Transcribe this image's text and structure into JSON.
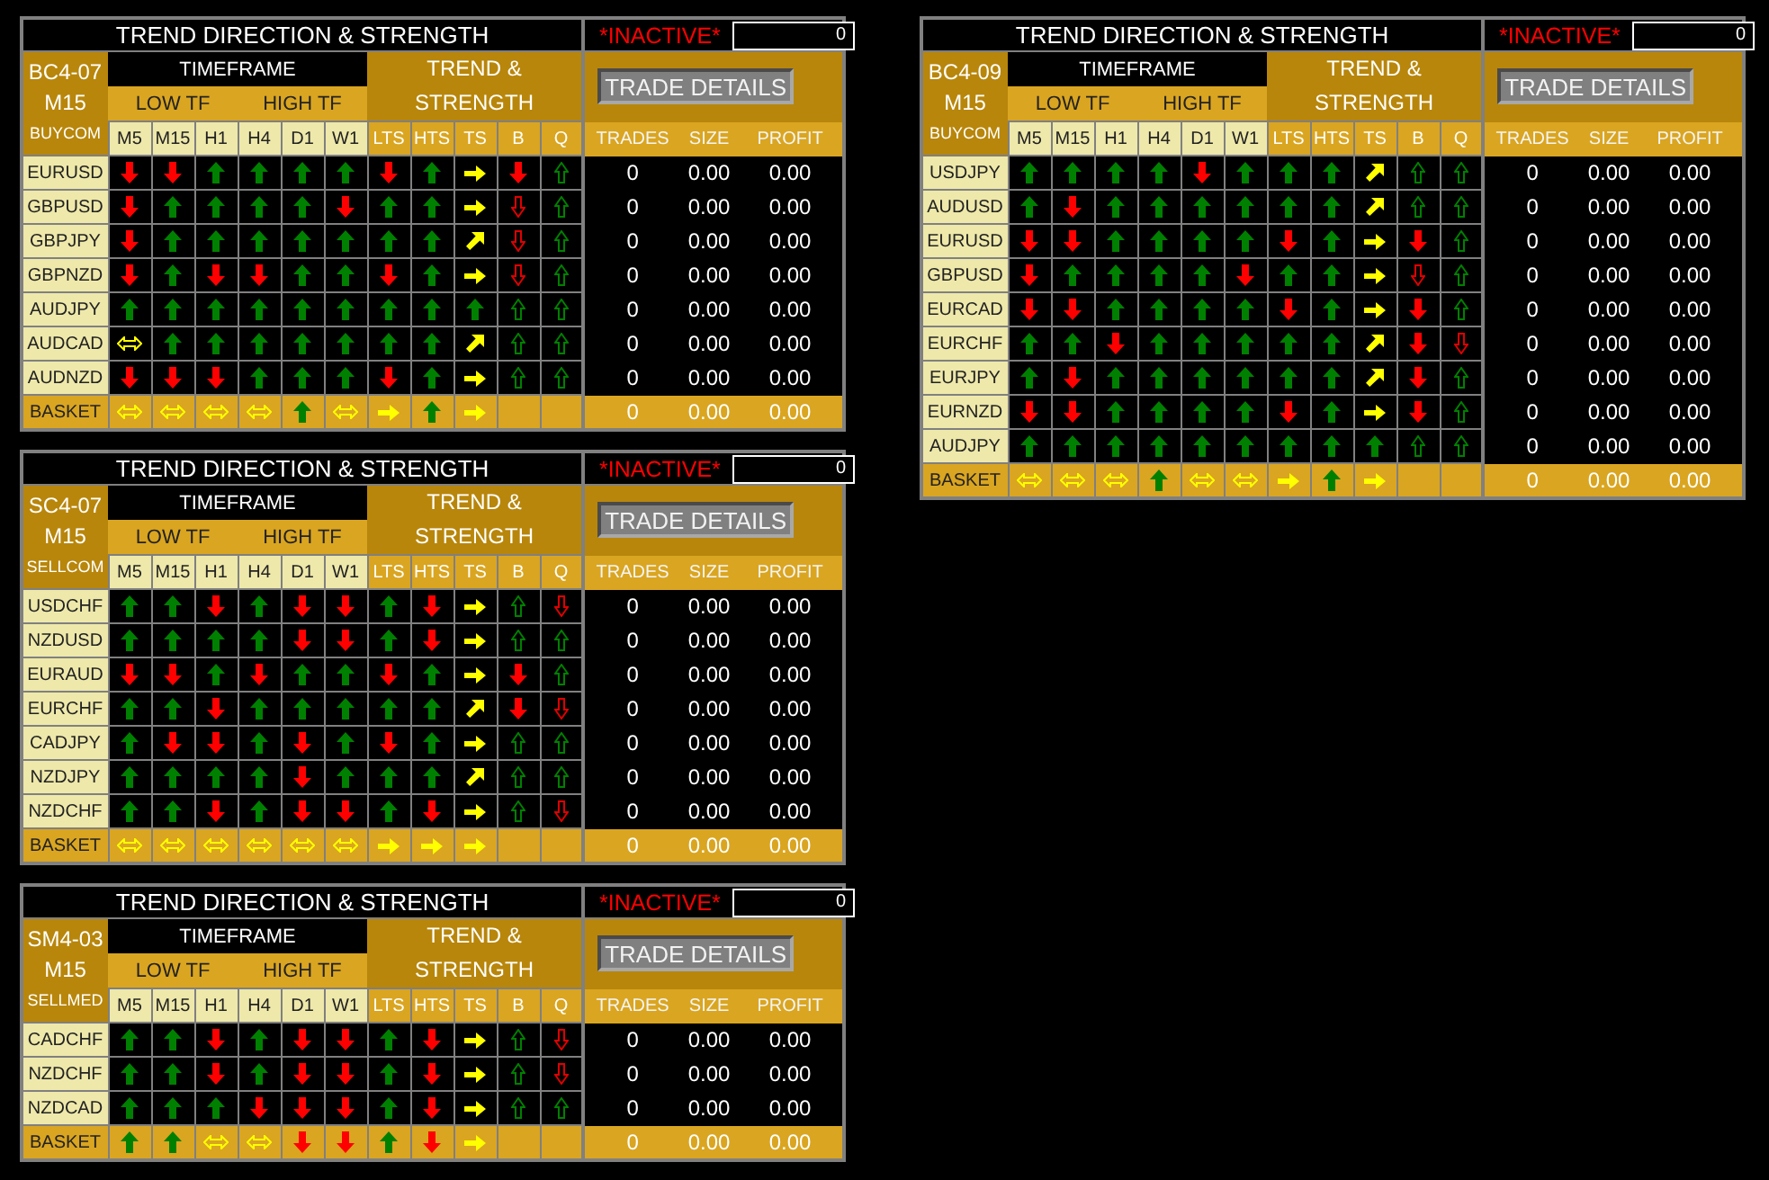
{
  "panels": [
    {
      "title": "TREND DIRECTION & STRENGTH",
      "status": "*INACTIVE*",
      "counter": "0",
      "code": "BC4-07",
      "chart_timeframe": "M15",
      "mode": "BUYCOM",
      "timeframe_header": "TIMEFRAME",
      "low_tf": "LOW TF",
      "high_tf": "HIGH TF",
      "trend_header": "TREND & STRENGTH",
      "button": "TRADE DETAILS",
      "columns": [
        "M5",
        "M15",
        "H1",
        "H4",
        "D1",
        "W1",
        "LTS",
        "HTS",
        "TS",
        "B",
        "Q"
      ],
      "stats_columns": [
        "TRADES",
        "SIZE",
        "PROFIT"
      ],
      "rows": [
        {
          "pair": "EURUSD",
          "signals": [
            {
              "kind": "down"
            },
            {
              "kind": "down"
            },
            {
              "kind": "up"
            },
            {
              "kind": "up"
            },
            {
              "kind": "up"
            },
            {
              "kind": "up"
            },
            {
              "kind": "down"
            },
            {
              "kind": "up"
            },
            {
              "kind": "right"
            },
            {
              "kind": "down"
            },
            {
              "kind": "up_outline"
            }
          ],
          "trades": "0",
          "size": "0.00",
          "profit": "0.00"
        },
        {
          "pair": "GBPUSD",
          "signals": [
            {
              "kind": "down"
            },
            {
              "kind": "up"
            },
            {
              "kind": "up"
            },
            {
              "kind": "up"
            },
            {
              "kind": "up"
            },
            {
              "kind": "down"
            },
            {
              "kind": "up"
            },
            {
              "kind": "up"
            },
            {
              "kind": "right"
            },
            {
              "kind": "down_outline"
            },
            {
              "kind": "up_outline"
            }
          ],
          "trades": "0",
          "size": "0.00",
          "profit": "0.00"
        },
        {
          "pair": "GBPJPY",
          "signals": [
            {
              "kind": "down"
            },
            {
              "kind": "up"
            },
            {
              "kind": "up"
            },
            {
              "kind": "up"
            },
            {
              "kind": "up"
            },
            {
              "kind": "up"
            },
            {
              "kind": "up"
            },
            {
              "kind": "up"
            },
            {
              "kind": "up_right"
            },
            {
              "kind": "down_outline"
            },
            {
              "kind": "up_outline"
            }
          ],
          "trades": "0",
          "size": "0.00",
          "profit": "0.00"
        },
        {
          "pair": "GBPNZD",
          "signals": [
            {
              "kind": "down"
            },
            {
              "kind": "up"
            },
            {
              "kind": "down"
            },
            {
              "kind": "down"
            },
            {
              "kind": "up"
            },
            {
              "kind": "up"
            },
            {
              "kind": "down"
            },
            {
              "kind": "up"
            },
            {
              "kind": "right"
            },
            {
              "kind": "down_outline"
            },
            {
              "kind": "up_outline"
            }
          ],
          "trades": "0",
          "size": "0.00",
          "profit": "0.00"
        },
        {
          "pair": "AUDJPY",
          "signals": [
            {
              "kind": "up"
            },
            {
              "kind": "up"
            },
            {
              "kind": "up"
            },
            {
              "kind": "up"
            },
            {
              "kind": "up"
            },
            {
              "kind": "up"
            },
            {
              "kind": "up"
            },
            {
              "kind": "up"
            },
            {
              "kind": "up"
            },
            {
              "kind": "up_outline"
            },
            {
              "kind": "up_outline"
            }
          ],
          "trades": "0",
          "size": "0.00",
          "profit": "0.00"
        },
        {
          "pair": "AUDCAD",
          "signals": [
            {
              "kind": "flat"
            },
            {
              "kind": "up"
            },
            {
              "kind": "up"
            },
            {
              "kind": "up"
            },
            {
              "kind": "up"
            },
            {
              "kind": "up"
            },
            {
              "kind": "up"
            },
            {
              "kind": "up"
            },
            {
              "kind": "up_right"
            },
            {
              "kind": "up_outline"
            },
            {
              "kind": "up_outline"
            }
          ],
          "trades": "0",
          "size": "0.00",
          "profit": "0.00"
        },
        {
          "pair": "AUDNZD",
          "signals": [
            {
              "kind": "down"
            },
            {
              "kind": "down"
            },
            {
              "kind": "down"
            },
            {
              "kind": "up"
            },
            {
              "kind": "up"
            },
            {
              "kind": "up"
            },
            {
              "kind": "down"
            },
            {
              "kind": "up"
            },
            {
              "kind": "right"
            },
            {
              "kind": "up_outline"
            },
            {
              "kind": "up_outline"
            }
          ],
          "trades": "0",
          "size": "0.00",
          "profit": "0.00"
        }
      ],
      "basket": {
        "label": "BASKET",
        "signals": [
          {
            "kind": "flat"
          },
          {
            "kind": "flat"
          },
          {
            "kind": "flat"
          },
          {
            "kind": "flat"
          },
          {
            "kind": "up"
          },
          {
            "kind": "flat"
          },
          {
            "kind": "right"
          },
          {
            "kind": "up"
          },
          {
            "kind": "right"
          }
        ],
        "trades": "0",
        "size": "0.00",
        "profit": "0.00"
      }
    },
    {
      "title": "TREND DIRECTION & STRENGTH",
      "status": "*INACTIVE*",
      "counter": "0",
      "code": "BC4-09",
      "chart_timeframe": "M15",
      "mode": "BUYCOM",
      "timeframe_header": "TIMEFRAME",
      "low_tf": "LOW TF",
      "high_tf": "HIGH TF",
      "trend_header": "TREND & STRENGTH",
      "button": "TRADE DETAILS",
      "columns": [
        "M5",
        "M15",
        "H1",
        "H4",
        "D1",
        "W1",
        "LTS",
        "HTS",
        "TS",
        "B",
        "Q"
      ],
      "stats_columns": [
        "TRADES",
        "SIZE",
        "PROFIT"
      ],
      "rows": [
        {
          "pair": "USDJPY",
          "signals": [
            {
              "kind": "up"
            },
            {
              "kind": "up"
            },
            {
              "kind": "up"
            },
            {
              "kind": "up"
            },
            {
              "kind": "down"
            },
            {
              "kind": "up"
            },
            {
              "kind": "up"
            },
            {
              "kind": "up"
            },
            {
              "kind": "up_right"
            },
            {
              "kind": "up_outline"
            },
            {
              "kind": "up_outline"
            }
          ],
          "trades": "0",
          "size": "0.00",
          "profit": "0.00"
        },
        {
          "pair": "AUDUSD",
          "signals": [
            {
              "kind": "up"
            },
            {
              "kind": "down"
            },
            {
              "kind": "up"
            },
            {
              "kind": "up"
            },
            {
              "kind": "up"
            },
            {
              "kind": "up"
            },
            {
              "kind": "up"
            },
            {
              "kind": "up"
            },
            {
              "kind": "up_right"
            },
            {
              "kind": "up_outline"
            },
            {
              "kind": "up_outline"
            }
          ],
          "trades": "0",
          "size": "0.00",
          "profit": "0.00"
        },
        {
          "pair": "EURUSD",
          "signals": [
            {
              "kind": "down"
            },
            {
              "kind": "down"
            },
            {
              "kind": "up"
            },
            {
              "kind": "up"
            },
            {
              "kind": "up"
            },
            {
              "kind": "up"
            },
            {
              "kind": "down"
            },
            {
              "kind": "up"
            },
            {
              "kind": "right"
            },
            {
              "kind": "down"
            },
            {
              "kind": "up_outline"
            }
          ],
          "trades": "0",
          "size": "0.00",
          "profit": "0.00"
        },
        {
          "pair": "GBPUSD",
          "signals": [
            {
              "kind": "down"
            },
            {
              "kind": "up"
            },
            {
              "kind": "up"
            },
            {
              "kind": "up"
            },
            {
              "kind": "up"
            },
            {
              "kind": "down"
            },
            {
              "kind": "up"
            },
            {
              "kind": "up"
            },
            {
              "kind": "right"
            },
            {
              "kind": "down_outline"
            },
            {
              "kind": "up_outline"
            }
          ],
          "trades": "0",
          "size": "0.00",
          "profit": "0.00"
        },
        {
          "pair": "EURCAD",
          "signals": [
            {
              "kind": "down"
            },
            {
              "kind": "down"
            },
            {
              "kind": "up"
            },
            {
              "kind": "up"
            },
            {
              "kind": "up"
            },
            {
              "kind": "up"
            },
            {
              "kind": "down"
            },
            {
              "kind": "up"
            },
            {
              "kind": "right"
            },
            {
              "kind": "down"
            },
            {
              "kind": "up_outline"
            }
          ],
          "trades": "0",
          "size": "0.00",
          "profit": "0.00"
        },
        {
          "pair": "EURCHF",
          "signals": [
            {
              "kind": "up"
            },
            {
              "kind": "up"
            },
            {
              "kind": "down"
            },
            {
              "kind": "up"
            },
            {
              "kind": "up"
            },
            {
              "kind": "up"
            },
            {
              "kind": "up"
            },
            {
              "kind": "up"
            },
            {
              "kind": "up_right"
            },
            {
              "kind": "down"
            },
            {
              "kind": "down_outline"
            }
          ],
          "trades": "0",
          "size": "0.00",
          "profit": "0.00"
        },
        {
          "pair": "EURJPY",
          "signals": [
            {
              "kind": "up"
            },
            {
              "kind": "down"
            },
            {
              "kind": "up"
            },
            {
              "kind": "up"
            },
            {
              "kind": "up"
            },
            {
              "kind": "up"
            },
            {
              "kind": "up"
            },
            {
              "kind": "up"
            },
            {
              "kind": "up_right"
            },
            {
              "kind": "down"
            },
            {
              "kind": "up_outline"
            }
          ],
          "trades": "0",
          "size": "0.00",
          "profit": "0.00"
        },
        {
          "pair": "EURNZD",
          "signals": [
            {
              "kind": "down"
            },
            {
              "kind": "down"
            },
            {
              "kind": "up"
            },
            {
              "kind": "up"
            },
            {
              "kind": "up"
            },
            {
              "kind": "up"
            },
            {
              "kind": "down"
            },
            {
              "kind": "up"
            },
            {
              "kind": "right"
            },
            {
              "kind": "down"
            },
            {
              "kind": "up_outline"
            }
          ],
          "trades": "0",
          "size": "0.00",
          "profit": "0.00"
        },
        {
          "pair": "AUDJPY",
          "signals": [
            {
              "kind": "up"
            },
            {
              "kind": "up"
            },
            {
              "kind": "up"
            },
            {
              "kind": "up"
            },
            {
              "kind": "up"
            },
            {
              "kind": "up"
            },
            {
              "kind": "up"
            },
            {
              "kind": "up"
            },
            {
              "kind": "up"
            },
            {
              "kind": "up_outline"
            },
            {
              "kind": "up_outline"
            }
          ],
          "trades": "0",
          "size": "0.00",
          "profit": "0.00"
        }
      ],
      "basket": {
        "label": "BASKET",
        "signals": [
          {
            "kind": "flat"
          },
          {
            "kind": "flat"
          },
          {
            "kind": "flat"
          },
          {
            "kind": "up"
          },
          {
            "kind": "flat"
          },
          {
            "kind": "flat"
          },
          {
            "kind": "right"
          },
          {
            "kind": "up"
          },
          {
            "kind": "right"
          }
        ],
        "trades": "0",
        "size": "0.00",
        "profit": "0.00"
      }
    },
    {
      "title": "TREND DIRECTION & STRENGTH",
      "status": "*INACTIVE*",
      "counter": "0",
      "code": "SC4-07",
      "chart_timeframe": "M15",
      "mode": "SELLCOM",
      "timeframe_header": "TIMEFRAME",
      "low_tf": "LOW TF",
      "high_tf": "HIGH TF",
      "trend_header": "TREND & STRENGTH",
      "button": "TRADE DETAILS",
      "columns": [
        "M5",
        "M15",
        "H1",
        "H4",
        "D1",
        "W1",
        "LTS",
        "HTS",
        "TS",
        "B",
        "Q"
      ],
      "stats_columns": [
        "TRADES",
        "SIZE",
        "PROFIT"
      ],
      "rows": [
        {
          "pair": "USDCHF",
          "signals": [
            {
              "kind": "up"
            },
            {
              "kind": "up"
            },
            {
              "kind": "down"
            },
            {
              "kind": "up"
            },
            {
              "kind": "down"
            },
            {
              "kind": "down"
            },
            {
              "kind": "up"
            },
            {
              "kind": "down"
            },
            {
              "kind": "right"
            },
            {
              "kind": "up_outline"
            },
            {
              "kind": "down_outline"
            }
          ],
          "trades": "0",
          "size": "0.00",
          "profit": "0.00"
        },
        {
          "pair": "NZDUSD",
          "signals": [
            {
              "kind": "up"
            },
            {
              "kind": "up"
            },
            {
              "kind": "up"
            },
            {
              "kind": "up"
            },
            {
              "kind": "down"
            },
            {
              "kind": "down"
            },
            {
              "kind": "up"
            },
            {
              "kind": "down"
            },
            {
              "kind": "right"
            },
            {
              "kind": "up_outline"
            },
            {
              "kind": "up_outline"
            }
          ],
          "trades": "0",
          "size": "0.00",
          "profit": "0.00"
        },
        {
          "pair": "EURAUD",
          "signals": [
            {
              "kind": "down"
            },
            {
              "kind": "down"
            },
            {
              "kind": "up"
            },
            {
              "kind": "down"
            },
            {
              "kind": "up"
            },
            {
              "kind": "up"
            },
            {
              "kind": "down"
            },
            {
              "kind": "up"
            },
            {
              "kind": "right"
            },
            {
              "kind": "down"
            },
            {
              "kind": "up_outline"
            }
          ],
          "trades": "0",
          "size": "0.00",
          "profit": "0.00"
        },
        {
          "pair": "EURCHF",
          "signals": [
            {
              "kind": "up"
            },
            {
              "kind": "up"
            },
            {
              "kind": "down"
            },
            {
              "kind": "up"
            },
            {
              "kind": "up"
            },
            {
              "kind": "up"
            },
            {
              "kind": "up"
            },
            {
              "kind": "up"
            },
            {
              "kind": "up_right"
            },
            {
              "kind": "down"
            },
            {
              "kind": "down_outline"
            }
          ],
          "trades": "0",
          "size": "0.00",
          "profit": "0.00"
        },
        {
          "pair": "CADJPY",
          "signals": [
            {
              "kind": "up"
            },
            {
              "kind": "down"
            },
            {
              "kind": "down"
            },
            {
              "kind": "up"
            },
            {
              "kind": "down"
            },
            {
              "kind": "up"
            },
            {
              "kind": "down"
            },
            {
              "kind": "up"
            },
            {
              "kind": "right"
            },
            {
              "kind": "up_outline"
            },
            {
              "kind": "up_outline"
            }
          ],
          "trades": "0",
          "size": "0.00",
          "profit": "0.00"
        },
        {
          "pair": "NZDJPY",
          "signals": [
            {
              "kind": "up"
            },
            {
              "kind": "up"
            },
            {
              "kind": "up"
            },
            {
              "kind": "up"
            },
            {
              "kind": "down"
            },
            {
              "kind": "up"
            },
            {
              "kind": "up"
            },
            {
              "kind": "up"
            },
            {
              "kind": "up_right"
            },
            {
              "kind": "up_outline"
            },
            {
              "kind": "up_outline"
            }
          ],
          "trades": "0",
          "size": "0.00",
          "profit": "0.00"
        },
        {
          "pair": "NZDCHF",
          "signals": [
            {
              "kind": "up"
            },
            {
              "kind": "up"
            },
            {
              "kind": "down"
            },
            {
              "kind": "up"
            },
            {
              "kind": "down"
            },
            {
              "kind": "down"
            },
            {
              "kind": "up"
            },
            {
              "kind": "down"
            },
            {
              "kind": "right"
            },
            {
              "kind": "up_outline"
            },
            {
              "kind": "down_outline"
            }
          ],
          "trades": "0",
          "size": "0.00",
          "profit": "0.00"
        }
      ],
      "basket": {
        "label": "BASKET",
        "signals": [
          {
            "kind": "flat"
          },
          {
            "kind": "flat"
          },
          {
            "kind": "flat"
          },
          {
            "kind": "flat"
          },
          {
            "kind": "flat"
          },
          {
            "kind": "flat"
          },
          {
            "kind": "right"
          },
          {
            "kind": "right"
          },
          {
            "kind": "right"
          }
        ],
        "trades": "0",
        "size": "0.00",
        "profit": "0.00"
      }
    },
    {
      "title": "TREND DIRECTION & STRENGTH",
      "status": "*INACTIVE*",
      "counter": "0",
      "code": "SM4-03",
      "chart_timeframe": "M15",
      "mode": "SELLMED",
      "timeframe_header": "TIMEFRAME",
      "low_tf": "LOW TF",
      "high_tf": "HIGH TF",
      "trend_header": "TREND & STRENGTH",
      "button": "TRADE DETAILS",
      "columns": [
        "M5",
        "M15",
        "H1",
        "H4",
        "D1",
        "W1",
        "LTS",
        "HTS",
        "TS",
        "B",
        "Q"
      ],
      "stats_columns": [
        "TRADES",
        "SIZE",
        "PROFIT"
      ],
      "rows": [
        {
          "pair": "CADCHF",
          "signals": [
            {
              "kind": "up"
            },
            {
              "kind": "up"
            },
            {
              "kind": "down"
            },
            {
              "kind": "up"
            },
            {
              "kind": "down"
            },
            {
              "kind": "down"
            },
            {
              "kind": "up"
            },
            {
              "kind": "down"
            },
            {
              "kind": "right"
            },
            {
              "kind": "up_outline"
            },
            {
              "kind": "down_outline"
            }
          ],
          "trades": "0",
          "size": "0.00",
          "profit": "0.00"
        },
        {
          "pair": "NZDCHF",
          "signals": [
            {
              "kind": "up"
            },
            {
              "kind": "up"
            },
            {
              "kind": "down"
            },
            {
              "kind": "up"
            },
            {
              "kind": "down"
            },
            {
              "kind": "down"
            },
            {
              "kind": "up"
            },
            {
              "kind": "down"
            },
            {
              "kind": "right"
            },
            {
              "kind": "up_outline"
            },
            {
              "kind": "down_outline"
            }
          ],
          "trades": "0",
          "size": "0.00",
          "profit": "0.00"
        },
        {
          "pair": "NZDCAD",
          "signals": [
            {
              "kind": "up"
            },
            {
              "kind": "up"
            },
            {
              "kind": "up"
            },
            {
              "kind": "down"
            },
            {
              "kind": "down"
            },
            {
              "kind": "down"
            },
            {
              "kind": "up"
            },
            {
              "kind": "down"
            },
            {
              "kind": "right"
            },
            {
              "kind": "up_outline"
            },
            {
              "kind": "up_outline"
            }
          ],
          "trades": "0",
          "size": "0.00",
          "profit": "0.00"
        }
      ],
      "basket": {
        "label": "BASKET",
        "signals": [
          {
            "kind": "up"
          },
          {
            "kind": "up"
          },
          {
            "kind": "flat"
          },
          {
            "kind": "flat"
          },
          {
            "kind": "down"
          },
          {
            "kind": "down"
          },
          {
            "kind": "up"
          },
          {
            "kind": "down"
          },
          {
            "kind": "right"
          }
        ],
        "trades": "0",
        "size": "0.00",
        "profit": "0.00"
      }
    }
  ]
}
